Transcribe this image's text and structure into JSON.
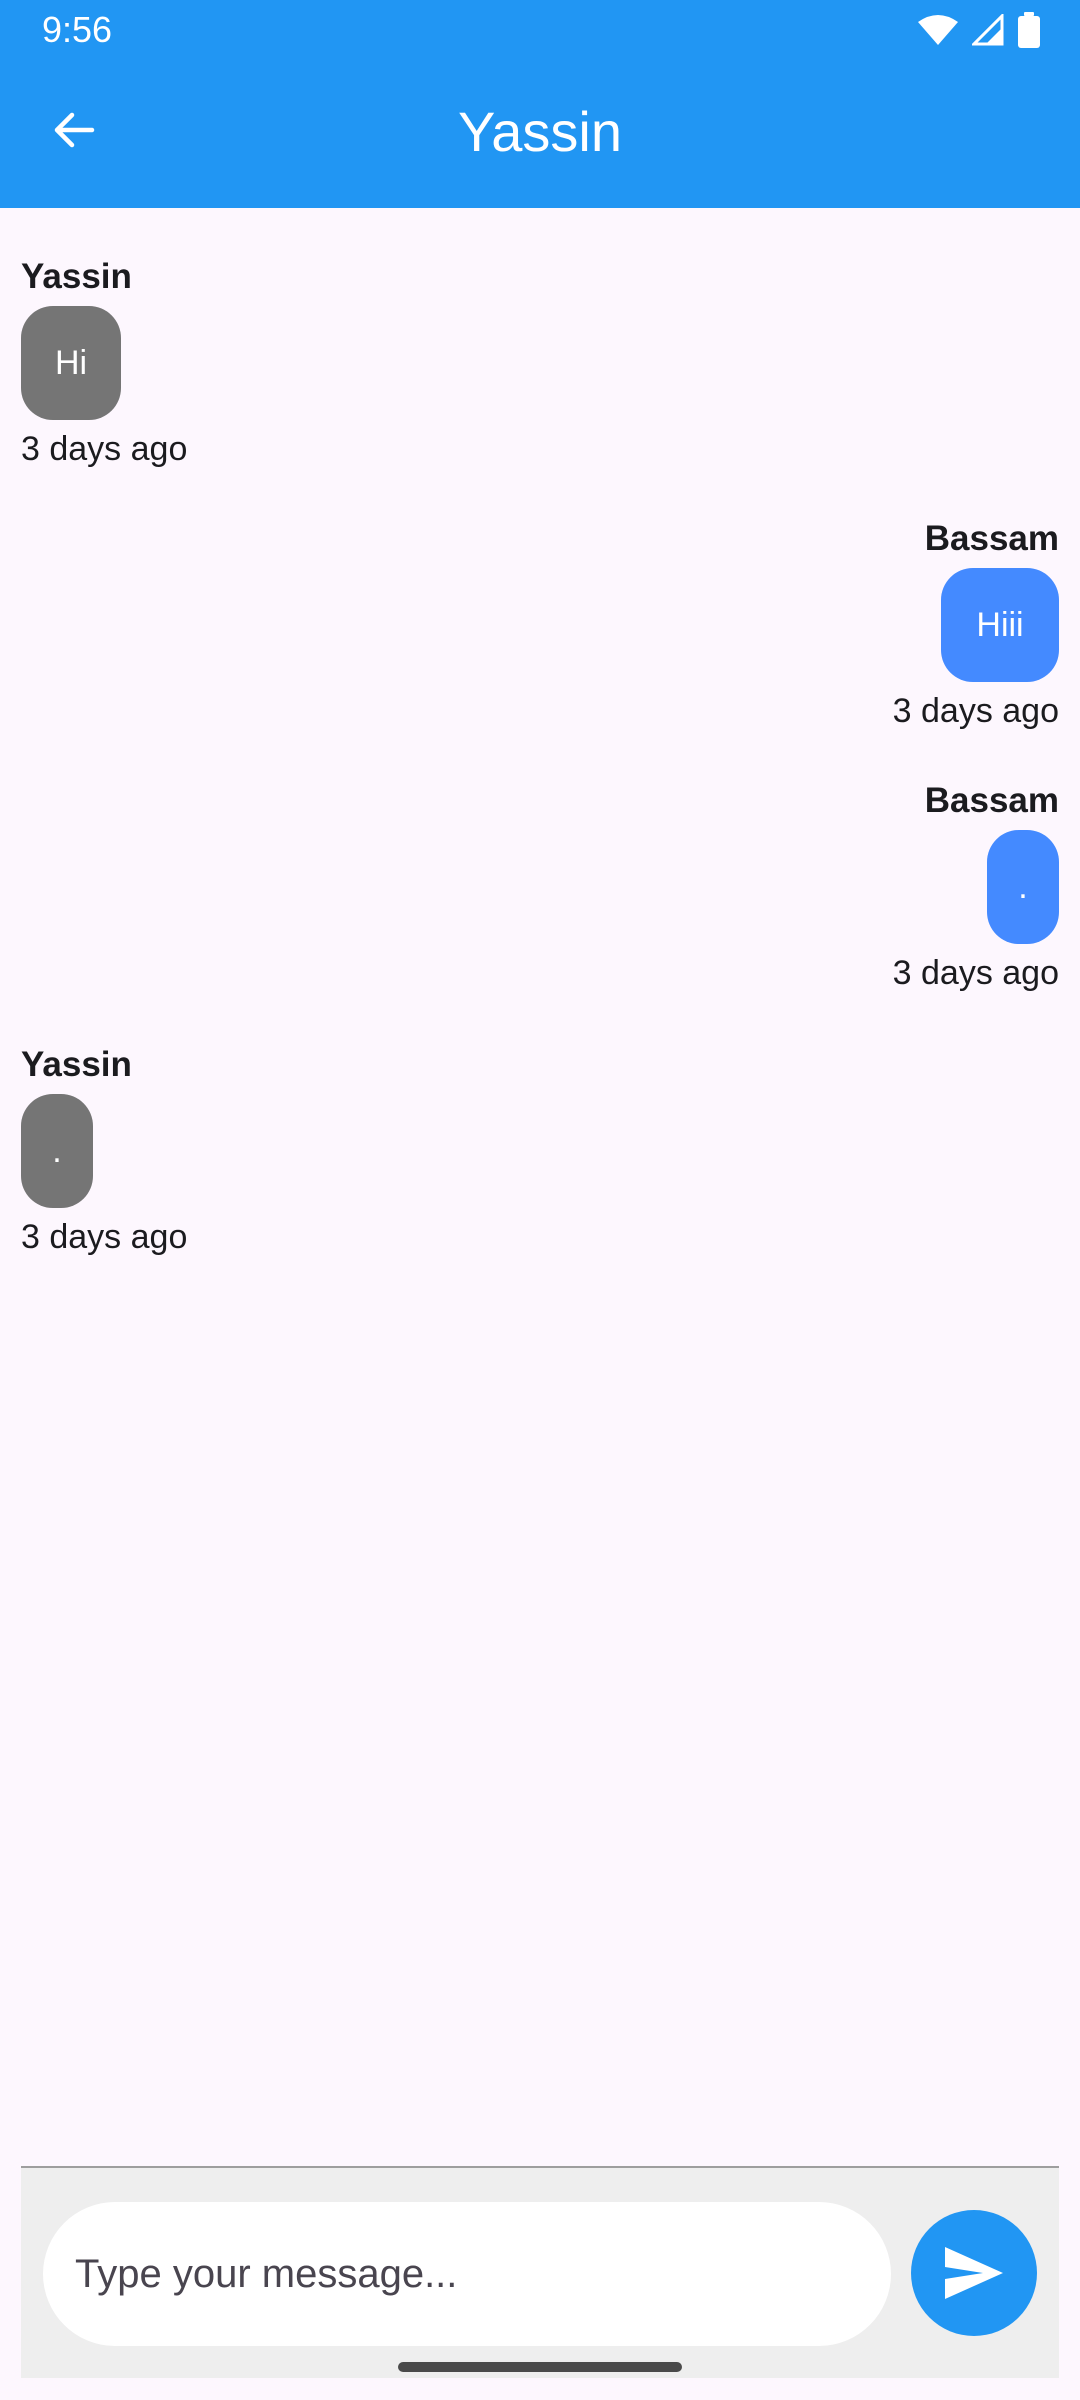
{
  "status_bar": {
    "time": "9:56",
    "icons": [
      "wifi-icon",
      "cellular-signal-icon",
      "battery-icon"
    ]
  },
  "app_bar": {
    "title": "Yassin",
    "back_icon": "arrow-back-icon",
    "color": "#2196F3"
  },
  "messages": [
    {
      "sender": "Yassin",
      "text": "Hi",
      "time": "3 days ago",
      "side": "left",
      "bubble_color": "#757575"
    },
    {
      "sender": "Bassam",
      "text": "Hiii",
      "time": "3 days ago",
      "side": "right",
      "bubble_color": "#448AFF"
    },
    {
      "sender": "Bassam",
      "text": ".",
      "time": "3 days ago",
      "side": "right",
      "bubble_color": "#448AFF"
    },
    {
      "sender": "Yassin",
      "text": ".",
      "time": "3 days ago",
      "side": "left",
      "bubble_color": "#757575"
    }
  ],
  "composer": {
    "placeholder": "Type your message...",
    "value": "",
    "send_icon": "send-icon"
  }
}
